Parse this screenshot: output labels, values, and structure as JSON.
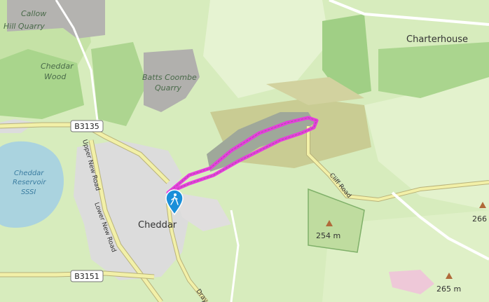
{
  "map": {
    "places": {
      "charterhouse": "Charterhouse",
      "cheddar": "Cheddar"
    },
    "features": {
      "callow_quarry_line1": "Callow",
      "callow_quarry_line2": "Hill Quarry",
      "cheddar_wood_line1": "Cheddar",
      "cheddar_wood_line2": "Wood",
      "batts_combe_line1": "Batts Coombe",
      "batts_combe_line2": "Quarry",
      "reservoir_line1": "Cheddar",
      "reservoir_line2": "Reservoir",
      "reservoir_line3": "SSSI"
    },
    "roads": {
      "b3135": "B3135",
      "b3151": "B3151",
      "upper_new_road": "Upper New Road",
      "lower_new_road": "Lower New Road",
      "cliff_road": "Cliff Road",
      "draycott_partial": "Drayc"
    },
    "elevations": {
      "e254": "254 m",
      "e265": "265 m",
      "e266": "266"
    },
    "colors": {
      "route": "#e83ae0",
      "marker": "#1a8fd9",
      "road_yellow": "#f2f0a8",
      "road_outline": "#b8b27a",
      "water": "#aad3df",
      "quarry": "#aaa9a6"
    },
    "icons": {
      "trailhead": "hiker-icon"
    }
  }
}
